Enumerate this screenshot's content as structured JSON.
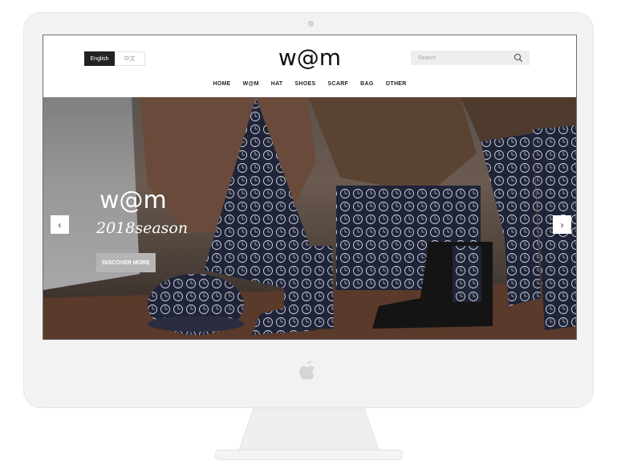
{
  "header": {
    "lang_en": "English",
    "lang_zh": "中文",
    "logo": "w@m",
    "search_placeholder": "Search"
  },
  "nav": [
    "HOME",
    "W@M",
    "HAT",
    "SHOES",
    "SCARF",
    "BAG",
    "OTHER"
  ],
  "hero": {
    "logo": "w@m",
    "season": "2018season",
    "cta": "DISCOVER MORE"
  },
  "icons": {
    "search": "search-icon",
    "prev": "chevron-left-icon",
    "next": "chevron-right-icon",
    "apple": "apple-logo"
  },
  "colors": {
    "lang_active": "#222222",
    "cta": "#b5b5b5",
    "search_bg": "#eeeeee"
  }
}
